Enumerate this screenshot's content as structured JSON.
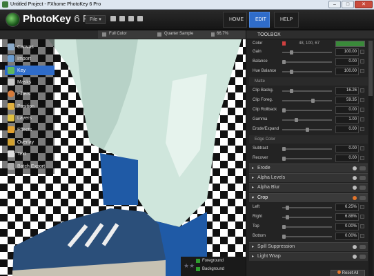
{
  "window": {
    "title": "Untitled Project - FXhome PhotoKey 6 Pro"
  },
  "app": {
    "name": "PhotoKey",
    "version": "6 Pro"
  },
  "menu": {
    "file": "File",
    "file_caret": "▾"
  },
  "nav": {
    "home": "HOME",
    "edit": "EDIT",
    "help": "HELP"
  },
  "view": {
    "mode": "Full Color",
    "sample": "Quarter Sample",
    "zoom": "66.7%"
  },
  "sidebar": {
    "items": [
      {
        "label": "Canvas",
        "icon": "canvas-icon",
        "color": "#8aa9c8"
      },
      {
        "label": "Import",
        "icon": "import-icon",
        "color": "#6a9cd0"
      },
      {
        "label": "Key",
        "icon": "key-icon",
        "color": "#5fb85f"
      },
      {
        "label": "Masks",
        "icon": "masks-icon",
        "color": "#c8c8c8"
      },
      {
        "label": "Filters",
        "icon": "filters-icon",
        "color": "#d47a3a"
      },
      {
        "label": "Position",
        "icon": "position-icon",
        "color": "#e0b040"
      },
      {
        "label": "Layers",
        "icon": "layers-icon",
        "color": "#e0c040"
      },
      {
        "label": "Effects",
        "icon": "effects-icon",
        "color": "#e0a030"
      },
      {
        "label": "Overlay",
        "icon": "overlay-icon",
        "color": "#d0a030"
      },
      {
        "label": "Text",
        "icon": "text-icon",
        "color": "#dddddd"
      },
      {
        "label": "Batch Export",
        "icon": "batch-export-icon",
        "color": "#aaaaaa"
      }
    ],
    "active": "Key"
  },
  "layers": {
    "foreground": "Foreground",
    "background": "Background"
  },
  "toolbox": {
    "title": "TOOLBOX",
    "color_row": {
      "label": "Color",
      "value": "48, 100, 67",
      "swatch": "#3a8a3a"
    },
    "rows": [
      {
        "label": "Gain",
        "value": "100.00"
      },
      {
        "label": "Balance",
        "value": "0.00"
      },
      {
        "label": "Hue Balance",
        "value": "100.00"
      }
    ],
    "matte_label": "Matte",
    "matte_rows": [
      {
        "label": "Clip Backg.",
        "value": "16.26"
      },
      {
        "label": "Clip Foreg.",
        "value": "59.35"
      },
      {
        "label": "Clip Rollback",
        "value": "0.00"
      },
      {
        "label": "Gamma",
        "value": "1.00"
      },
      {
        "label": "Erode/Expand",
        "value": "0.00"
      }
    ],
    "edge_label": "Edge Color",
    "edge_rows": [
      {
        "label": "Subtract",
        "value": "0.00"
      },
      {
        "label": "Recover",
        "value": "0.00"
      }
    ],
    "panels": [
      "Erode",
      "Alpha Levels",
      "Alpha Blur"
    ],
    "crop": {
      "title": "Crop",
      "rows": [
        {
          "label": "Left",
          "value": "6.25%"
        },
        {
          "label": "Right",
          "value": "6.88%"
        },
        {
          "label": "Top",
          "value": "0.00%"
        },
        {
          "label": "Bottom",
          "value": "0.00%"
        }
      ]
    },
    "panels2": [
      "Spill Suppression",
      "Light Wrap"
    ],
    "reset": "Reset All"
  }
}
